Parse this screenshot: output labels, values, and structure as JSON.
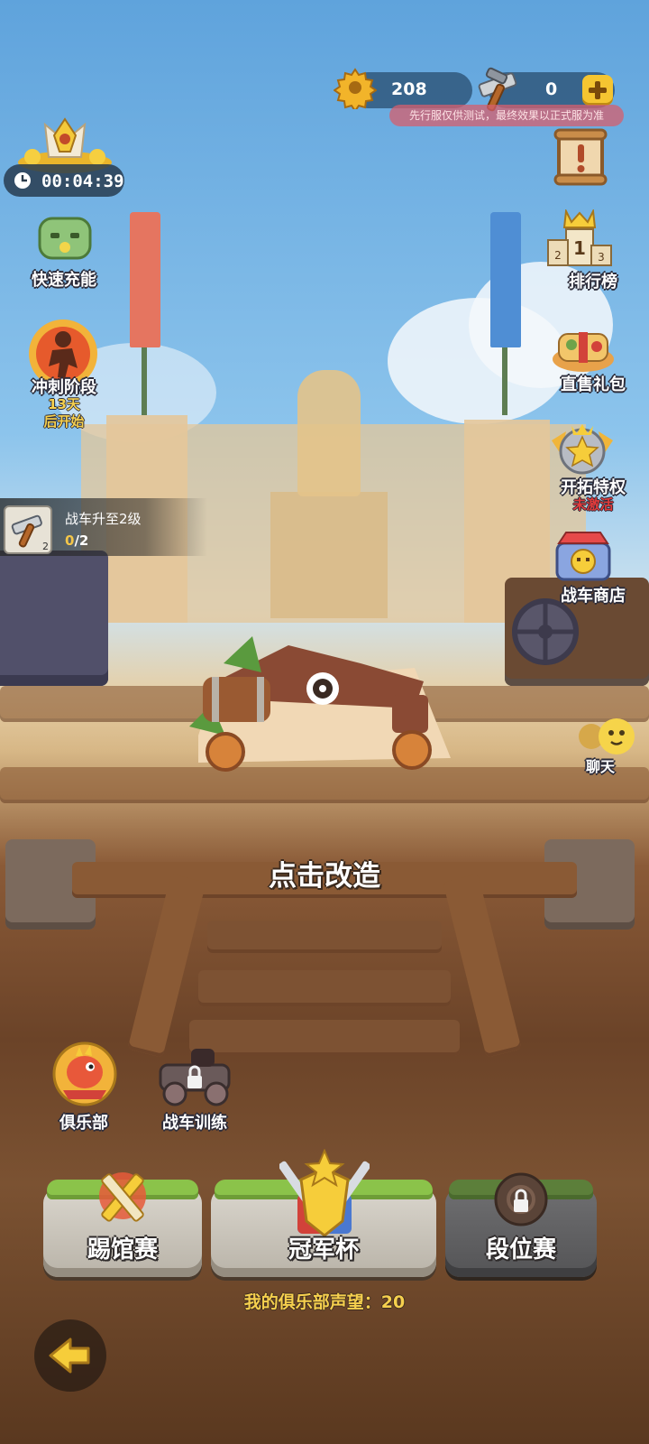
{
  "currency": {
    "gears": "208",
    "tools": "0"
  },
  "notice": "先行服仅供测试，最终效果以正式服为准",
  "timer": "00:04:39",
  "left_menu": {
    "quick_charge": "快速充能",
    "sprint_stage": "冲刺阶段",
    "sprint_days": "13天",
    "sprint_start": "后开始"
  },
  "right_menu": {
    "ranking": "排行榜",
    "gift_pack": "直售礼包",
    "privilege": "开拓特权",
    "privilege_status": "未激活",
    "chariot_shop": "战车商店",
    "chat": "聊天",
    "rank_number": "1",
    "rank_2": "2",
    "rank_3": "3"
  },
  "task": {
    "title": "战车升至2级",
    "progress_done": "0",
    "progress_total": "/2",
    "badge": "2"
  },
  "tap_to_modify": "点击改造",
  "bottom_icons": {
    "club": "俱乐部",
    "chariot_training": "战车训练"
  },
  "modes": {
    "challenge": "踢馆赛",
    "champion_cup": "冠军杯",
    "ranked": "段位赛"
  },
  "club_prestige": "我的俱乐部声望：20",
  "colors": {
    "accent_gold": "#f6d04e",
    "status_red": "#e23b3b",
    "currency_pill": "#30587c"
  }
}
